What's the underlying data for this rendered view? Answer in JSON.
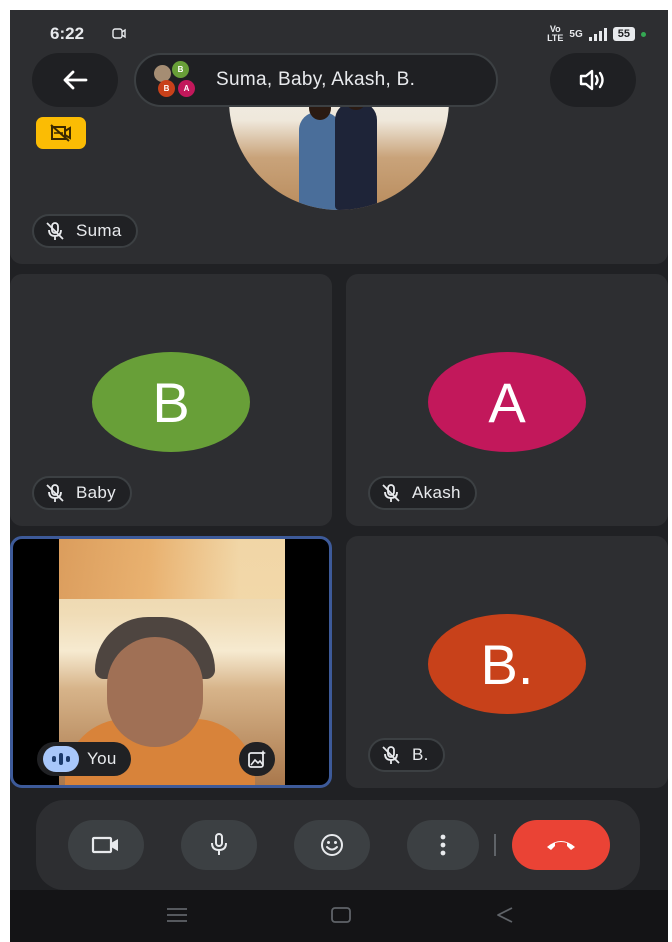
{
  "status_bar": {
    "time": "6:22",
    "volte": "Vo\nLTE",
    "network": "5G",
    "battery": "55"
  },
  "header": {
    "participants_title": "Suma, Baby, Akash, B.",
    "mini_avatars": [
      "",
      "B",
      "B",
      "A"
    ]
  },
  "participants": [
    {
      "name": "Suma",
      "initial": "",
      "color": "",
      "muted": true
    },
    {
      "name": "Baby",
      "initial": "B",
      "color": "#689f38",
      "muted": true
    },
    {
      "name": "Akash",
      "initial": "A",
      "color": "#c2185b",
      "muted": true
    },
    {
      "name": "You",
      "initial": "",
      "color": "",
      "muted": false
    },
    {
      "name": "B.",
      "initial": "B.",
      "color": "#c8411a",
      "muted": true
    }
  ],
  "colors": {
    "background": "#202124",
    "tile": "#2d2e31",
    "end_call": "#ea4335",
    "self_border": "#3d5a99",
    "video_off_badge": "#fbbc04"
  },
  "icons": [
    "back-arrow-icon",
    "speaker-icon",
    "video-off-icon",
    "mic-off-icon",
    "talking-indicator-icon",
    "effects-icon",
    "camera-icon",
    "mic-icon",
    "emoji-icon",
    "more-vert-icon",
    "end-call-icon",
    "recents-icon",
    "home-icon",
    "back-icon"
  ]
}
